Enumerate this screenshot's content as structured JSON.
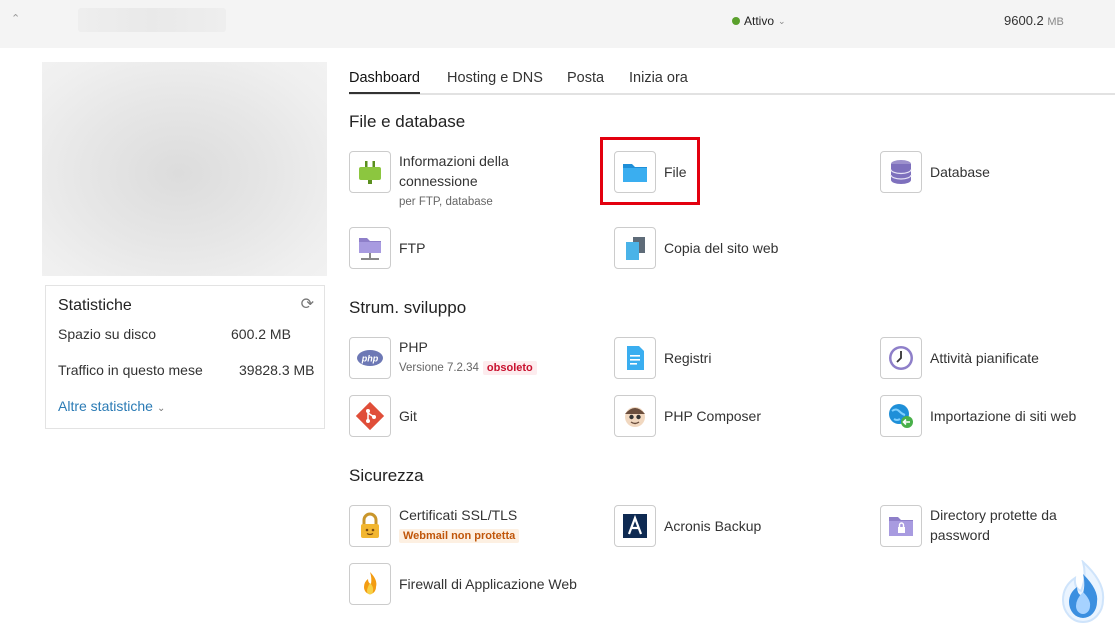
{
  "topbar": {
    "collapse_icon": "chevron-up-icon",
    "status_label": "Attivo",
    "status_color": "#5aa02c",
    "disk_value": "9600.2",
    "disk_unit": "MB"
  },
  "stats": {
    "title": "Statistiche",
    "rows": [
      {
        "label": "Spazio su disco",
        "value": "600.2 MB"
      },
      {
        "label": "Traffico in questo mese",
        "value": "39828.3 MB"
      }
    ],
    "more_label": "Altre statistiche"
  },
  "tabs": [
    "Dashboard",
    "Hosting e DNS",
    "Posta",
    "Inizia ora"
  ],
  "sections": {
    "files": {
      "title": "File e database",
      "items": {
        "conn": {
          "label_line1": "Informazioni della",
          "label_line2": "connessione",
          "sub": "per FTP, database",
          "icon": "plug-icon"
        },
        "file": {
          "label": "File",
          "icon": "folder-icon"
        },
        "db": {
          "label": "Database",
          "icon": "database-icon"
        },
        "ftp": {
          "label": "FTP",
          "icon": "ftp-folder-icon"
        },
        "copy": {
          "label": "Copia del sito web",
          "icon": "copy-site-icon"
        }
      }
    },
    "dev": {
      "title": "Strum. sviluppo",
      "items": {
        "php": {
          "label": "PHP",
          "sub": "Versione 7.2.34",
          "badge": "obsoleto",
          "icon": "php-icon"
        },
        "logs": {
          "label": "Registri",
          "icon": "log-file-icon"
        },
        "cron": {
          "label": "Attività pianificate",
          "icon": "clock-icon"
        },
        "git": {
          "label": "Git",
          "icon": "git-icon"
        },
        "composer": {
          "label": "PHP Composer",
          "icon": "composer-icon"
        },
        "import": {
          "label": "Importazione di siti web",
          "icon": "globe-import-icon"
        }
      }
    },
    "security": {
      "title": "Sicurezza",
      "items": {
        "ssl": {
          "label": "Certificati SSL/TLS",
          "badge": "Webmail non protetta",
          "icon": "lock-icon"
        },
        "acronis": {
          "label": "Acronis Backup",
          "icon": "acronis-icon"
        },
        "dirs": {
          "label_line1": "Directory protette da",
          "label_line2": "password",
          "icon": "protected-folder-icon"
        },
        "waf": {
          "label": "Firewall di Applicazione Web",
          "icon": "flame-icon"
        }
      }
    }
  }
}
